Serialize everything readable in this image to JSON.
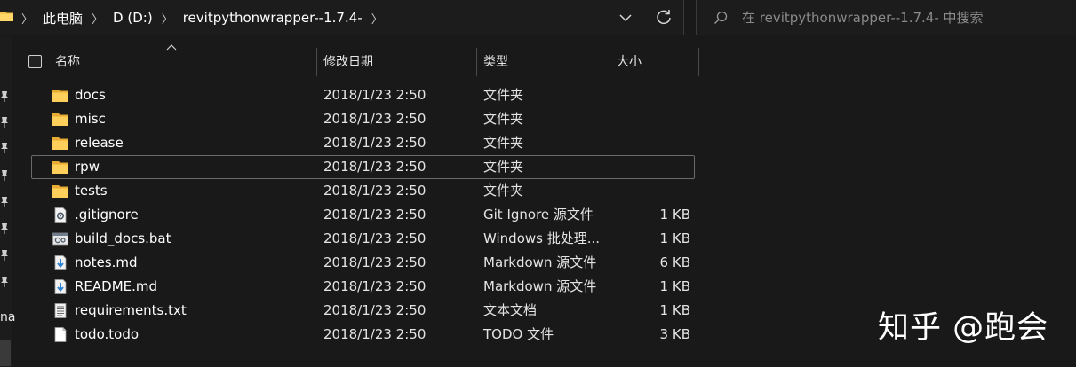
{
  "address_bar": {
    "breadcrumbs": [
      "此电脑",
      "D (D:)",
      "revitpythonwrapper--1.7.4-"
    ],
    "dropdown_icon": "chevron-down-icon",
    "refresh_icon": "refresh-icon"
  },
  "search": {
    "placeholder": "在 revitpythonwrapper--1.7.4- 中搜索",
    "icon": "search-icon"
  },
  "nav": {
    "partial_label": "na"
  },
  "columns": {
    "name": "名称",
    "date": "修改日期",
    "type": "类型",
    "size": "大小"
  },
  "files": [
    {
      "name": "docs",
      "date": "2018/1/23 2:50",
      "type": "文件夹",
      "size": "",
      "icon": "folder-icon"
    },
    {
      "name": "misc",
      "date": "2018/1/23 2:50",
      "type": "文件夹",
      "size": "",
      "icon": "folder-icon"
    },
    {
      "name": "release",
      "date": "2018/1/23 2:50",
      "type": "文件夹",
      "size": "",
      "icon": "folder-icon"
    },
    {
      "name": "rpw",
      "date": "2018/1/23 2:50",
      "type": "文件夹",
      "size": "",
      "icon": "folder-icon"
    },
    {
      "name": "tests",
      "date": "2018/1/23 2:50",
      "type": "文件夹",
      "size": "",
      "icon": "folder-icon"
    },
    {
      "name": ".gitignore",
      "date": "2018/1/23 2:50",
      "type": "Git Ignore 源文件",
      "size": "1 KB",
      "icon": "gear-file-icon"
    },
    {
      "name": "build_docs.bat",
      "date": "2018/1/23 2:50",
      "type": "Windows 批处理...",
      "size": "1 KB",
      "icon": "batch-file-icon"
    },
    {
      "name": "notes.md",
      "date": "2018/1/23 2:50",
      "type": "Markdown 源文件",
      "size": "6 KB",
      "icon": "markdown-file-icon"
    },
    {
      "name": "README.md",
      "date": "2018/1/23 2:50",
      "type": "Markdown 源文件",
      "size": "1 KB",
      "icon": "markdown-file-icon"
    },
    {
      "name": "requirements.txt",
      "date": "2018/1/23 2:50",
      "type": "文本文档",
      "size": "1 KB",
      "icon": "text-file-icon"
    },
    {
      "name": "todo.todo",
      "date": "2018/1/23 2:50",
      "type": "TODO 文件",
      "size": "3 KB",
      "icon": "blank-file-icon"
    }
  ],
  "watermark": "知乎 @跑会",
  "colors": {
    "background": "#191919",
    "folder": "#f3c54a",
    "markdown_icon": "#4a90d9"
  }
}
